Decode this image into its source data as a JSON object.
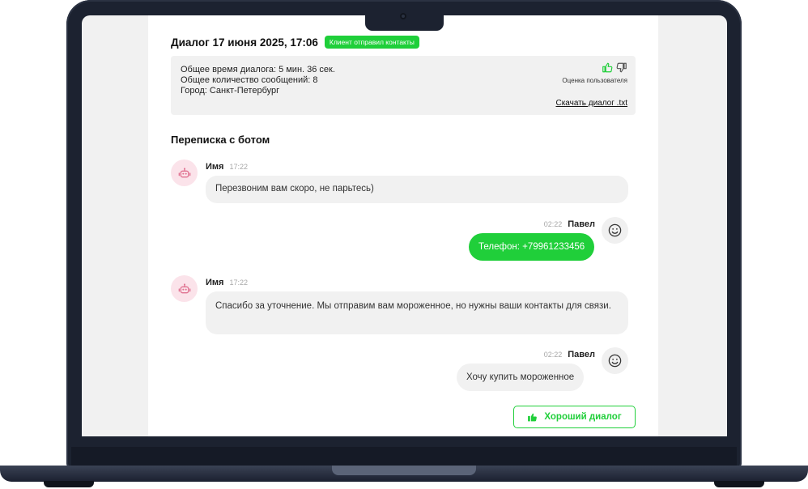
{
  "dialog": {
    "title": "Диалог 17 июня 2025, 17:06",
    "badge": "Клиент отправил контакты"
  },
  "info": {
    "total_time": "Общее время диалога: 5 мин. 36 сек.",
    "message_count": "Общее количество сообщений: 8",
    "city": "Город: Санкт-Петербург",
    "rating_label": "Оценка пользователя",
    "download_label": "Скачать диалог .txt"
  },
  "chat": {
    "section_title": "Переписка с ботом",
    "messages": [
      {
        "sender": "Имя",
        "time": "17:22",
        "text": "Перезвоним вам скоро, не парьтесь)"
      },
      {
        "sender": "Павел",
        "time": "02:22",
        "text": "Телефон: +79961233456"
      },
      {
        "sender": "Имя",
        "time": "17:22",
        "text": "Спасибо за уточнение. Мы отправим вам мороженное, но нужны ваши контакты для связи."
      },
      {
        "sender": "Павел",
        "time": "02:22",
        "text": "Хочу купить мороженное"
      }
    ]
  },
  "footer": {
    "good_dialog_label": "Хороший диалог"
  },
  "colors": {
    "accent": "#20cf3a",
    "bot_avatar_bg": "#fbe3ea",
    "bot_icon": "#e0708f",
    "bubble_bg": "#f1f1f1",
    "device_body": "#1c2230"
  },
  "icons": {
    "thumb_up": "thumbs-up-icon",
    "thumb_down": "thumbs-down-icon",
    "bot": "robot-icon",
    "user": "smiley-icon",
    "good_button": "thumbs-up-filled-icon"
  }
}
